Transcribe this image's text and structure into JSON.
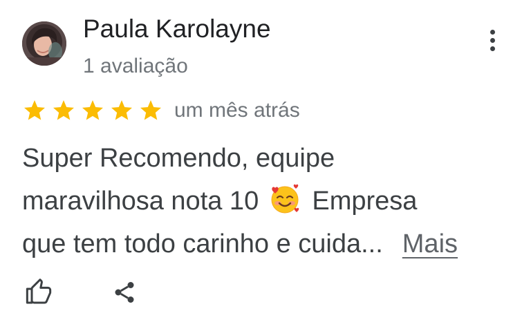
{
  "review": {
    "author_name": "Paula Karolayne",
    "review_count": "1 avaliação",
    "rating": 5,
    "rating_max": 5,
    "time_ago": "um mês atrás",
    "text_line_1": "Super Recomendo, equipe",
    "text_line_2a": "maravilhosa nota 10",
    "text_line_2b": "Empresa",
    "text_line_3": "que tem todo carinho e cuida...",
    "more_label": "Mais"
  },
  "icons": {
    "menu": "more-vert-icon",
    "star": "star-icon",
    "emoji": "smiling-face-with-hearts-icon",
    "like": "thumbs-up-icon",
    "share": "share-icon",
    "avatar": "avatar"
  },
  "colors": {
    "name": "#202124",
    "secondary": "#70757a",
    "body": "#3c4043",
    "star": "#fbbc04",
    "more_link": "#5f6368"
  }
}
